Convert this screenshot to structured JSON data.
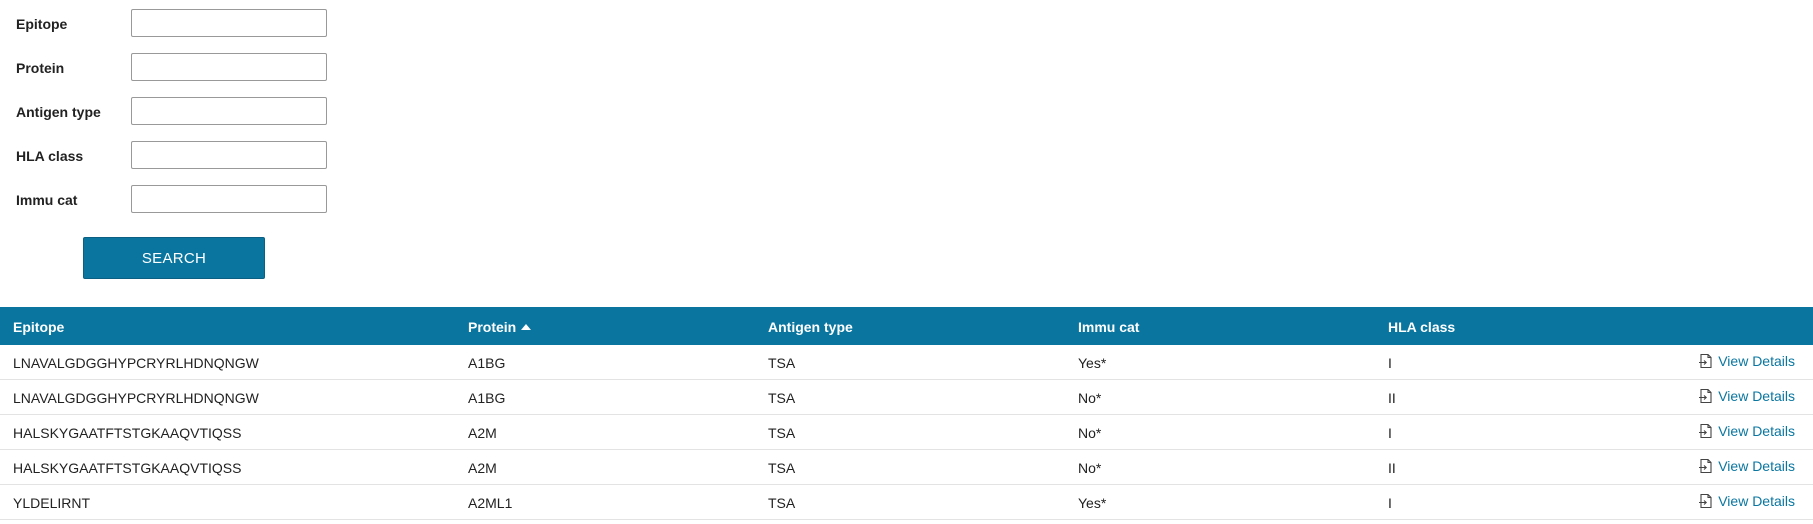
{
  "form": {
    "fields": [
      {
        "label": "Epitope",
        "value": ""
      },
      {
        "label": "Protein",
        "value": ""
      },
      {
        "label": "Antigen type",
        "value": ""
      },
      {
        "label": "HLA class",
        "value": ""
      },
      {
        "label": "Immu cat",
        "value": ""
      }
    ],
    "search_label": "SEARCH"
  },
  "table": {
    "headers": {
      "epitope": "Epitope",
      "protein": "Protein",
      "antigen_type": "Antigen type",
      "immu_cat": "Immu cat",
      "hla_class": "HLA class"
    },
    "sort": {
      "column": "protein",
      "direction": "ascending"
    },
    "rows": [
      {
        "epitope": "LNAVALGDGGHYPCRYRLHDNQNGW",
        "protein": "A1BG",
        "antigen_type": "TSA",
        "immu_cat": "Yes*",
        "hla_class": "I",
        "action": "View Details"
      },
      {
        "epitope": "LNAVALGDGGHYPCRYRLHDNQNGW",
        "protein": "A1BG",
        "antigen_type": "TSA",
        "immu_cat": "No*",
        "hla_class": "II",
        "action": "View Details"
      },
      {
        "epitope": "HALSKYGAATFTSTGKAAQVTIQSS",
        "protein": "A2M",
        "antigen_type": "TSA",
        "immu_cat": "No*",
        "hla_class": "I",
        "action": "View Details"
      },
      {
        "epitope": "HALSKYGAATFTSTGKAAQVTIQSS",
        "protein": "A2M",
        "antigen_type": "TSA",
        "immu_cat": "No*",
        "hla_class": "II",
        "action": "View Details"
      },
      {
        "epitope": "YLDELIRNT",
        "protein": "A2ML1",
        "antigen_type": "TSA",
        "immu_cat": "Yes*",
        "hla_class": "I",
        "action": "View Details"
      }
    ]
  },
  "icons": {
    "view_details": "document-arrow-icon",
    "sort": "sort-ascending-icon"
  },
  "colors": {
    "accent": "#0a76a0",
    "header_text": "#ffffff",
    "link": "#0a76a0"
  }
}
